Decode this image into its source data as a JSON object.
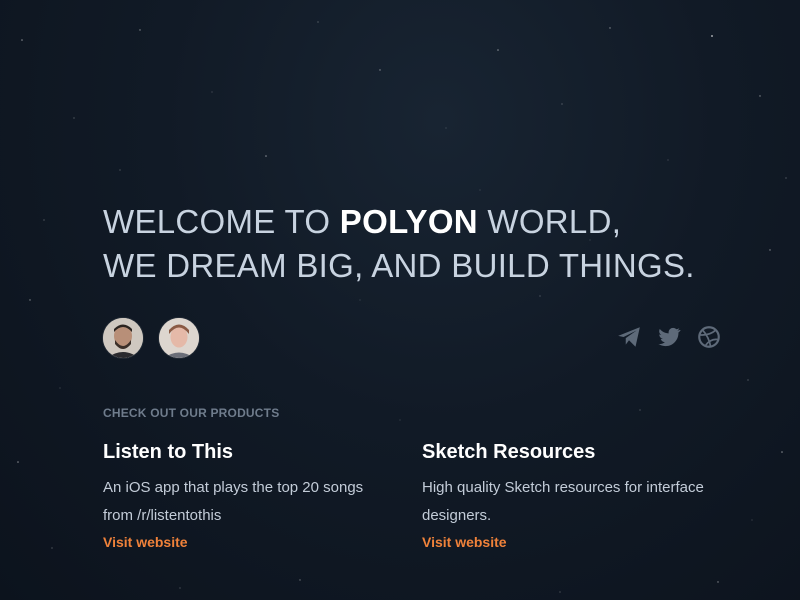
{
  "hero": {
    "prefix": "WELCOME TO ",
    "brand": "POLYON",
    "suffix": " WORLD,",
    "line2": "WE DREAM BIG, AND BUILD THINGS."
  },
  "team": [
    {
      "name": "team-member-1"
    },
    {
      "name": "team-member-2"
    }
  ],
  "social": [
    "paper-plane-icon",
    "twitter-icon",
    "dribbble-icon"
  ],
  "products": {
    "label": "CHECK OUT OUR PRODUCTS",
    "items": [
      {
        "title": "Listen to This",
        "description": "An iOS app that plays the top 20 songs from /r/listentothis",
        "link": "Visit website"
      },
      {
        "title": "Sketch Resources",
        "description": "High quality Sketch resources for interface designers.",
        "link": "Visit website"
      }
    ]
  },
  "colors": {
    "background": "#0f1722",
    "accent": "#f0823a",
    "heading": "#c8d3e0"
  }
}
